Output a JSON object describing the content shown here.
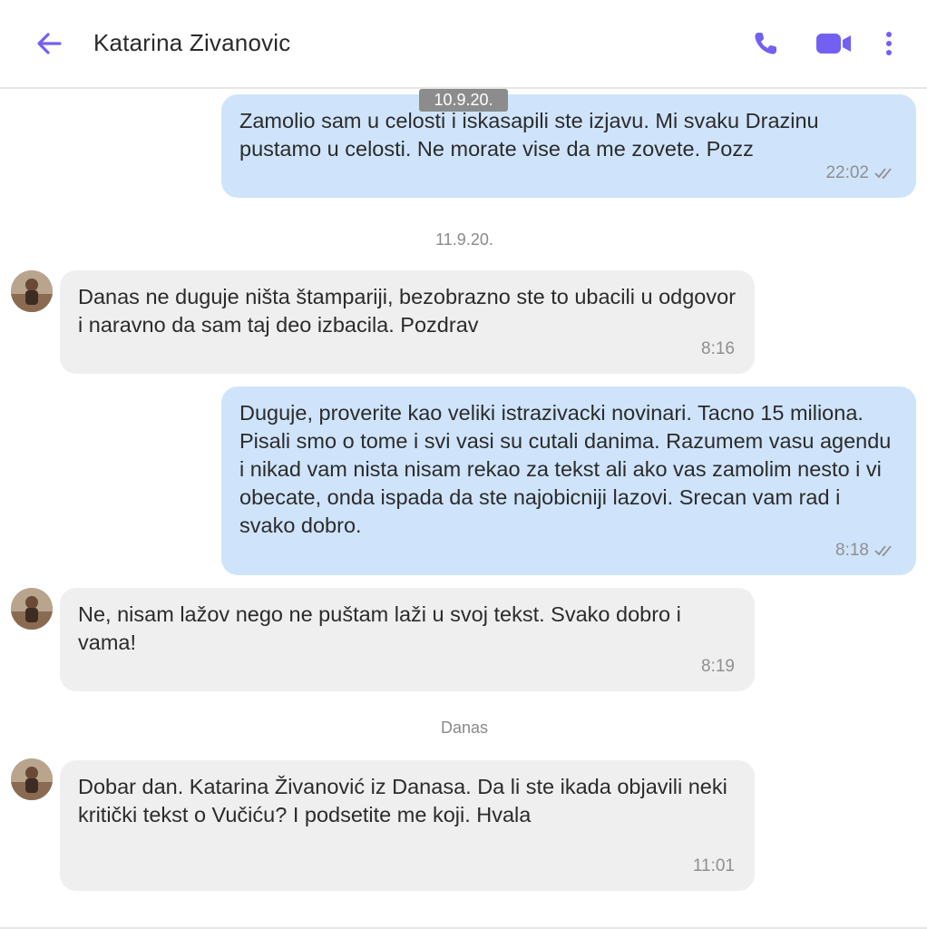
{
  "header": {
    "contact_name": "Katarina Zivanovic",
    "accent_color": "#7360f2",
    "icons": [
      "back-arrow-icon",
      "phone-icon",
      "video-call-icon",
      "more-vertical-icon"
    ]
  },
  "dates": {
    "d1": "10.9.20.",
    "d2": "11.9.20.",
    "d3": "Danas"
  },
  "messages": [
    {
      "direction": "out",
      "text": "Zamolio sam u celosti i iskasapili ste izjavu. Mi svaku Drazinu pustamo u celosti. Ne morate vise da me zovete. Pozz",
      "time": "22:02",
      "status": "delivered"
    },
    {
      "direction": "in",
      "text": "Danas ne duguje ništa štampariji, bezobrazno ste to ubacili u odgovor i naravno da sam taj deo izbacila. Pozdrav",
      "time": "8:16"
    },
    {
      "direction": "out",
      "text": "Duguje, proverite kao veliki istrazivacki novinari. Tacno 15 miliona. Pisali smo o tome i svi vasi su cutali danima. Razumem vasu agendu i nikad vam nista nisam rekao za tekst ali ako vas zamolim nesto i vi obecate, onda ispada da ste najobicniji lazovi. Srecan vam rad i svako dobro.",
      "time": "8:18",
      "status": "delivered"
    },
    {
      "direction": "in",
      "text": "Ne, nisam lažov nego ne puštam laži u svoj tekst. Svako dobro i vama!",
      "time": "8:19"
    },
    {
      "direction": "in",
      "text": "Dobar dan. Katarina Živanović iz Danasa. Da li ste ikada objavili neki kritički tekst o Vučiću? I podsetite me koji. Hvala",
      "time": "11:01"
    }
  ]
}
